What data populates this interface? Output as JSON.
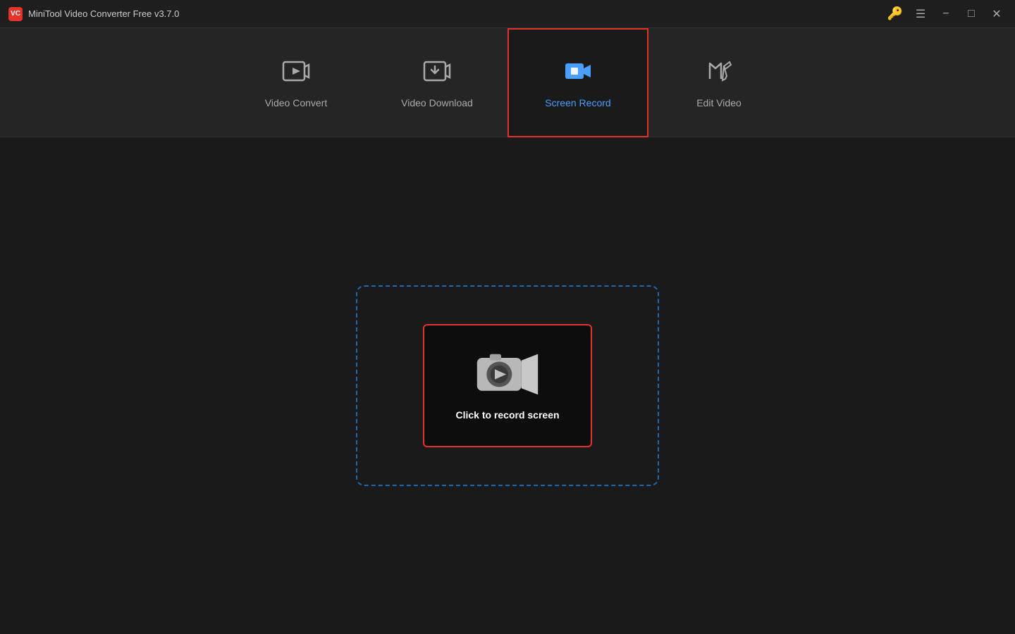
{
  "titleBar": {
    "appName": "MiniTool Video Converter Free v3.7.0",
    "logoText": "VC",
    "controls": {
      "minimize": "−",
      "maximize": "□",
      "close": "✕"
    }
  },
  "nav": {
    "items": [
      {
        "id": "video-convert",
        "label": "Video Convert",
        "active": false
      },
      {
        "id": "video-download",
        "label": "Video Download",
        "active": false
      },
      {
        "id": "screen-record",
        "label": "Screen Record",
        "active": true
      },
      {
        "id": "edit-video",
        "label": "Edit Video",
        "active": false
      }
    ]
  },
  "recordSection": {
    "buttonLabel": "Click to record screen"
  },
  "colors": {
    "active": "#4a9eff",
    "activeBorder": "#e63329",
    "dashedBorder": "#1e6ab0",
    "recordBorder": "#e63329"
  }
}
